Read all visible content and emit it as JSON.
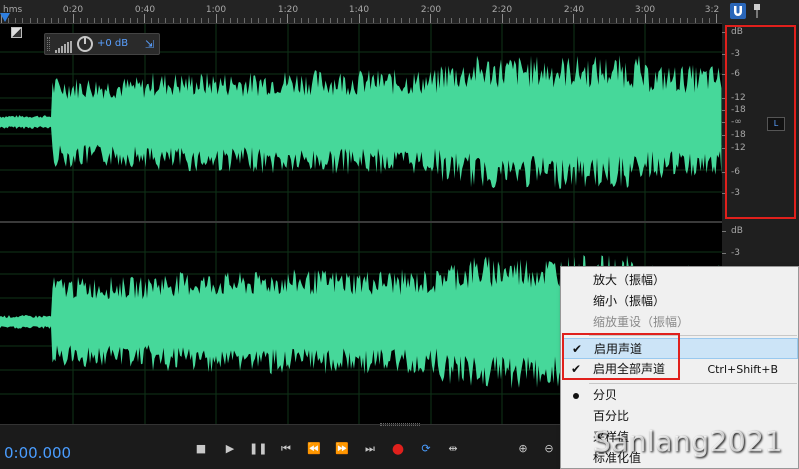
{
  "ruler": {
    "unit": "hms",
    "ticks": [
      "0:20",
      "0:40",
      "1:00",
      "1:20",
      "1:40",
      "2:00",
      "2:20",
      "2:40",
      "3:00",
      "3:2"
    ]
  },
  "hud": {
    "gain": "+0 dB"
  },
  "db_scale": {
    "top": [
      "dB",
      "-3",
      "-6",
      "-12",
      "-18",
      "-∞",
      "-18",
      "-12",
      "-6",
      "-3"
    ],
    "bottom": [
      "dB",
      "-3"
    ],
    "channel_label": "L"
  },
  "transport": {
    "time": "0:00.000"
  },
  "context_menu": {
    "items": [
      {
        "label": "放大（振幅）",
        "state": "normal"
      },
      {
        "label": "缩小（振幅）",
        "state": "normal"
      },
      {
        "label": "缩放重设（振幅）",
        "state": "disabled"
      },
      {
        "label": "启用声道",
        "state": "checked",
        "highlighted": true
      },
      {
        "label": "启用全部声道",
        "state": "checked",
        "shortcut": "Ctrl+Shift+B"
      },
      {
        "label": "分贝",
        "state": "selected"
      },
      {
        "label": "百分比",
        "state": "normal"
      },
      {
        "label": "采样值",
        "state": "normal"
      },
      {
        "label": "标准化值",
        "state": "normal"
      }
    ]
  },
  "watermark": "Sanlang2021",
  "colors": {
    "waveform": "#46d89a",
    "accent": "#4a9dff",
    "highlight_box": "#e0201c"
  }
}
